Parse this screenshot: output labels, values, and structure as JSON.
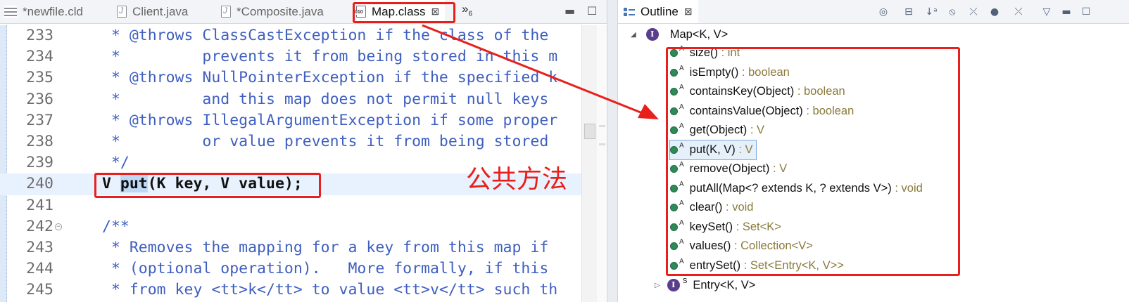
{
  "editor": {
    "tabs": [
      {
        "label": "*newfile.cld",
        "icon": "cld-file-icon"
      },
      {
        "label": "Client.java",
        "icon": "java-file-icon"
      },
      {
        "label": "*Composite.java",
        "icon": "java-file-icon"
      },
      {
        "label": "Map.class",
        "icon": "class-file-icon",
        "close": "⊠",
        "active": true
      }
    ],
    "overflow": "»",
    "overflow_count": "6",
    "lines": [
      {
        "num": "233",
        "code": " * @throws ClassCastException if the class of the"
      },
      {
        "num": "234",
        "code": " *         prevents it from being stored in this m"
      },
      {
        "num": "235",
        "code": " * @throws NullPointerException if the specified k"
      },
      {
        "num": "236",
        "code": " *         and this map does not permit null keys"
      },
      {
        "num": "237",
        "code": " * @throws IllegalArgumentException if some proper"
      },
      {
        "num": "238",
        "code": " *         or value prevents it from being stored"
      },
      {
        "num": "239",
        "code": " */"
      },
      {
        "num": "240",
        "code_pre": "V ",
        "code_sel": "put",
        "code_post": "(K key, V value);"
      },
      {
        "num": "241",
        "code": ""
      },
      {
        "num": "242",
        "code": "/**"
      },
      {
        "num": "243",
        "code": " * Removes the mapping for a key from this map if"
      },
      {
        "num": "244",
        "code": " * (optional operation).   More formally, if this"
      },
      {
        "num": "245",
        "code": " * from key <tt>k</tt> to value <tt>v</tt> such th"
      }
    ],
    "annotation": "公共方法"
  },
  "outline": {
    "title": "Outline",
    "close": "⊠",
    "root": "Map<K, V>",
    "members": [
      {
        "name": "size()",
        "type": " : int"
      },
      {
        "name": "isEmpty()",
        "type": " : boolean"
      },
      {
        "name": "containsKey(Object)",
        "type": " : boolean"
      },
      {
        "name": "containsValue(Object)",
        "type": " : boolean"
      },
      {
        "name": "get(Object)",
        "type": " : V"
      },
      {
        "name": "put(K, V)",
        "type": " : V",
        "selected": true
      },
      {
        "name": "remove(Object)",
        "type": " : V"
      },
      {
        "name": "putAll(Map<? extends K, ? extends V>)",
        "type": " : void"
      },
      {
        "name": "clear()",
        "type": " : void"
      },
      {
        "name": "keySet()",
        "type": " : Set<K>"
      },
      {
        "name": "values()",
        "type": " : Collection<V>"
      },
      {
        "name": "entrySet()",
        "type": " : Set<Entry<K, V>>"
      }
    ],
    "abstract_marker": "A",
    "interface_marker": "I",
    "entry": "Entry<K, V>",
    "static_marker": "S"
  },
  "colors": {
    "annotation_red": "#e8201c",
    "javadoc_blue": "#3f5fbf",
    "method_green": "#2e8b57"
  }
}
